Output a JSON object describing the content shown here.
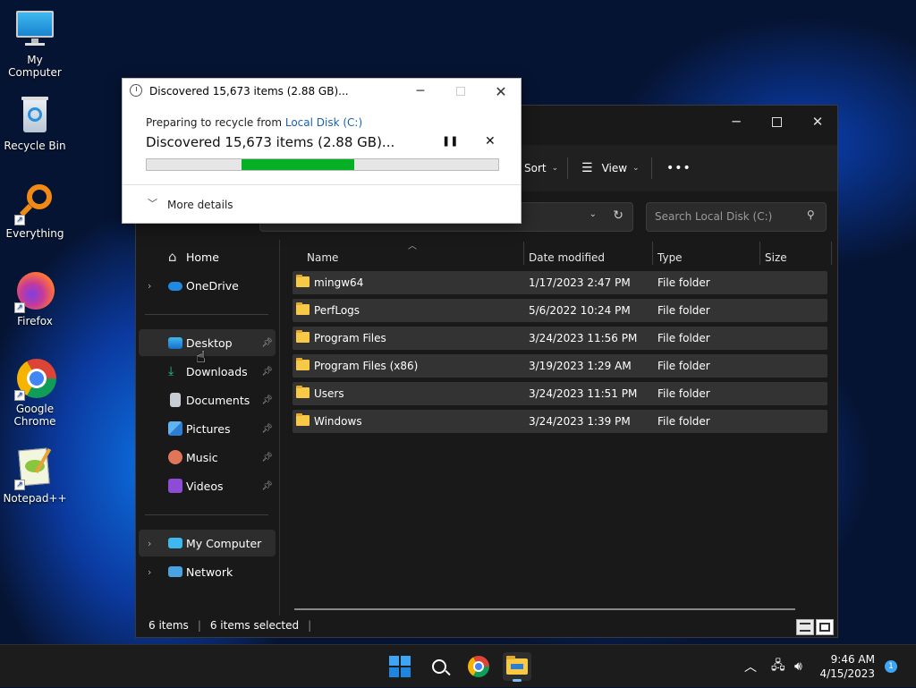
{
  "desktop": {
    "icons": [
      {
        "label": "My Computer",
        "icon": "monitor-icon"
      },
      {
        "label": "Recycle Bin",
        "icon": "recycle-bin-icon"
      },
      {
        "label": "Everything",
        "icon": "everything-search-icon"
      },
      {
        "label": "Firefox",
        "icon": "firefox-icon"
      },
      {
        "label": "Google Chrome",
        "icon": "chrome-icon"
      },
      {
        "label": "Notepad++",
        "icon": "notepadpp-icon"
      }
    ]
  },
  "explorer": {
    "toolbar": {
      "sort_label": "Sort",
      "view_label": "View",
      "more_label": "•••"
    },
    "search_placeholder": "Search Local Disk (C:)",
    "nav": {
      "home": "Home",
      "onedrive": "OneDrive",
      "desktop": "Desktop",
      "downloads": "Downloads",
      "documents": "Documents",
      "pictures": "Pictures",
      "music": "Music",
      "videos": "Videos",
      "mycomputer": "My Computer",
      "network": "Network"
    },
    "columns": {
      "name": "Name",
      "date": "Date modified",
      "type": "Type",
      "size": "Size"
    },
    "rows": [
      {
        "name": "mingw64",
        "date": "1/17/2023 2:47 PM",
        "type": "File folder"
      },
      {
        "name": "PerfLogs",
        "date": "5/6/2022 10:24 PM",
        "type": "File folder"
      },
      {
        "name": "Program Files",
        "date": "3/24/2023 11:56 PM",
        "type": "File folder"
      },
      {
        "name": "Program Files (x86)",
        "date": "3/19/2023 1:29 AM",
        "type": "File folder"
      },
      {
        "name": "Users",
        "date": "3/24/2023 11:51 PM",
        "type": "File folder"
      },
      {
        "name": "Windows",
        "date": "3/24/2023 1:39 PM",
        "type": "File folder"
      }
    ],
    "status": {
      "items": "6 items",
      "selected": "6 items selected"
    }
  },
  "dialog": {
    "title": "Discovered 15,673 items (2.88 GB)...",
    "prep_prefix": "Preparing to recycle from ",
    "prep_link": "Local Disk (C:)",
    "main_text": "Discovered 15,673 items (2.88 GB)...",
    "progress_start": 0.27,
    "progress_end": 0.59,
    "more_details": "More details",
    "progress_color": "#06b025"
  },
  "taskbar": {
    "time": "9:46 AM",
    "date": "4/15/2023",
    "notification_count": "1"
  }
}
